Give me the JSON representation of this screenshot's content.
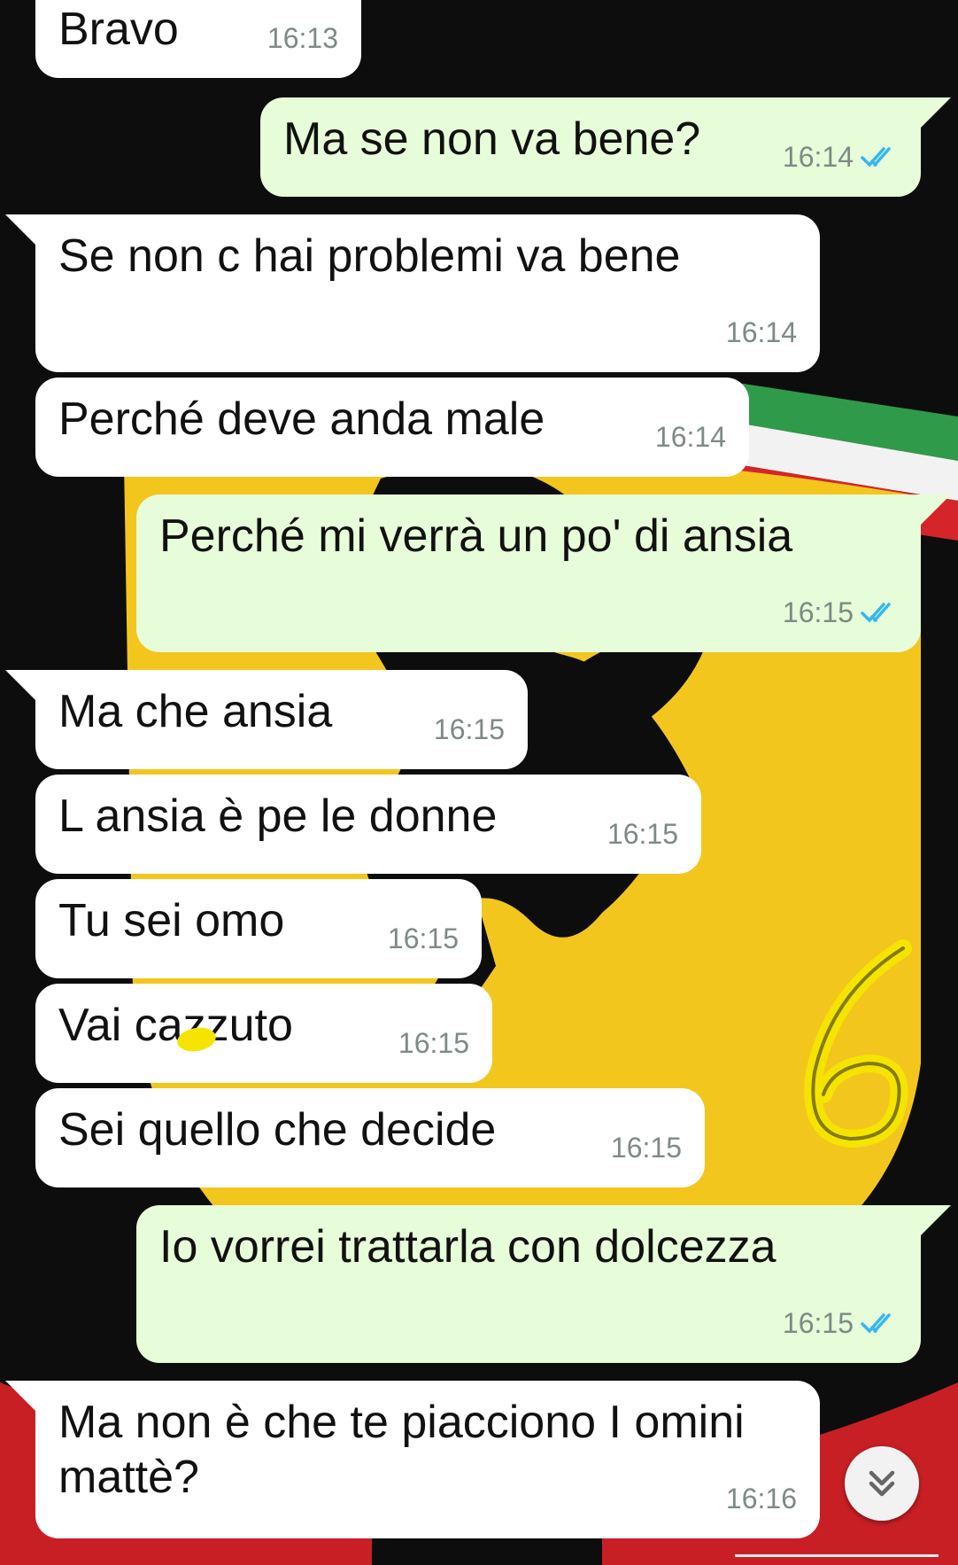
{
  "colors": {
    "incoming_bubble": "#ffffff",
    "outgoing_bubble": "#e7fcd8",
    "read_ticks": "#34b7f1",
    "timestamp": "#7d8a85",
    "wallpaper_yellow": "#f5cf22",
    "wallpaper_black": "#0e0e0e"
  },
  "messages": [
    {
      "direction": "in",
      "text": "Bravo",
      "time": "16:13",
      "read": false
    },
    {
      "direction": "out",
      "text": "Ma se non va bene?",
      "time": "16:14",
      "read": true
    },
    {
      "direction": "in",
      "text": "Se non c hai problemi va bene",
      "time": "16:14",
      "read": false
    },
    {
      "direction": "in",
      "text": "Perché deve anda male",
      "time": "16:14",
      "read": false
    },
    {
      "direction": "out",
      "text": "Perché mi verrà un po' di ansia",
      "time": "16:15",
      "read": true
    },
    {
      "direction": "in",
      "text": "Ma che ansia",
      "time": "16:15",
      "read": false
    },
    {
      "direction": "in",
      "text": "L ansia è pe le donne",
      "time": "16:15",
      "read": false
    },
    {
      "direction": "in",
      "text": "Tu sei omo",
      "time": "16:15",
      "read": false
    },
    {
      "direction": "in",
      "text": "Vai cazzuto",
      "time": "16:15",
      "read": false
    },
    {
      "direction": "in",
      "text": "Sei quello che decide",
      "time": "16:15",
      "read": false
    },
    {
      "direction": "out",
      "text": "Io vorrei trattarla con dolcezza",
      "time": "16:15",
      "read": true
    },
    {
      "direction": "in",
      "text": "Ma non è che te piacciono I omini mattè?",
      "time": "16:16",
      "read": false
    }
  ],
  "icons": {
    "scroll_down": "double-chevron-down-icon",
    "read_receipt": "double-check-icon"
  }
}
